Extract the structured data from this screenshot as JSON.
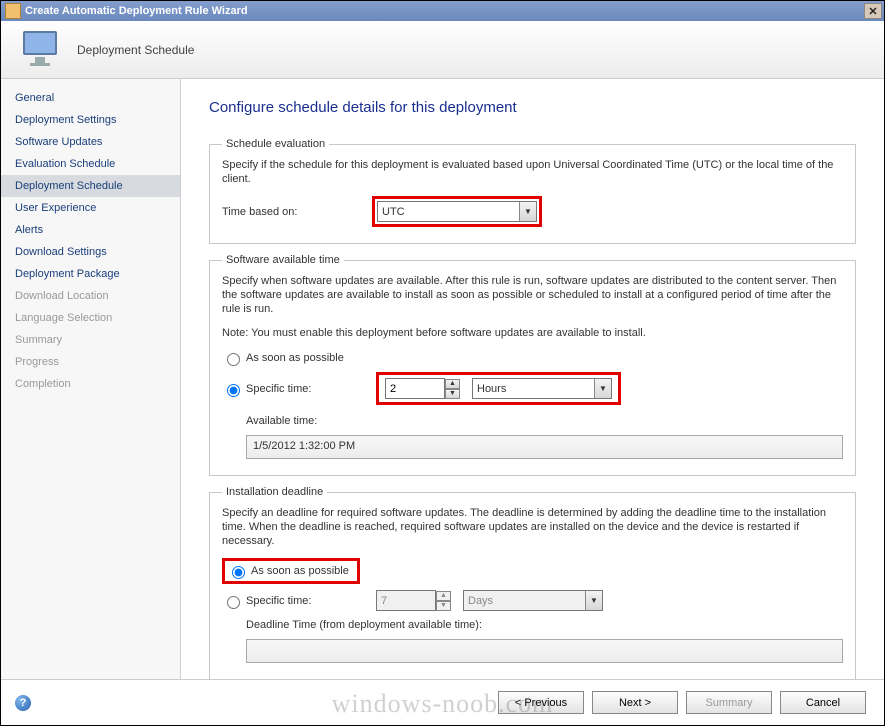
{
  "window": {
    "title": "Create Automatic Deployment Rule Wizard",
    "header_caption": "Deployment Schedule"
  },
  "nav": {
    "items": [
      {
        "label": "General",
        "state": "enabled"
      },
      {
        "label": "Deployment Settings",
        "state": "enabled"
      },
      {
        "label": "Software Updates",
        "state": "enabled"
      },
      {
        "label": "Evaluation Schedule",
        "state": "enabled"
      },
      {
        "label": "Deployment Schedule",
        "state": "selected"
      },
      {
        "label": "User Experience",
        "state": "enabled"
      },
      {
        "label": "Alerts",
        "state": "enabled"
      },
      {
        "label": "Download Settings",
        "state": "enabled"
      },
      {
        "label": "Deployment Package",
        "state": "enabled"
      },
      {
        "label": "Download Location",
        "state": "disabled"
      },
      {
        "label": "Language Selection",
        "state": "disabled"
      },
      {
        "label": "Summary",
        "state": "disabled"
      },
      {
        "label": "Progress",
        "state": "disabled"
      },
      {
        "label": "Completion",
        "state": "disabled"
      }
    ]
  },
  "page": {
    "title": "Configure schedule details for this deployment"
  },
  "schedule_eval": {
    "legend": "Schedule evaluation",
    "desc": "Specify if the schedule for this deployment is evaluated based upon Universal Coordinated Time (UTC) or the local time of the client.",
    "time_based_on_label": "Time based on:",
    "time_based_on_value": "UTC"
  },
  "available": {
    "legend": "Software available time",
    "desc": "Specify when software updates are available. After this rule is run, software updates are distributed to the content server. Then the software updates are available to install as soon as possible or scheduled to install at a configured period of time after the rule is run.",
    "note": "Note: You must enable this deployment before software updates are available to install.",
    "radio_asap": "As soon as possible",
    "radio_specific": "Specific time:",
    "specific_value": "2",
    "specific_unit": "Hours",
    "available_time_label": "Available time:",
    "available_time_value": "1/5/2012 1:32:00 PM"
  },
  "deadline": {
    "legend": "Installation deadline",
    "desc": "Specify an deadline for required software updates. The deadline is determined by adding the deadline time to the installation time. When the deadline is reached, required software updates are installed on the device and the device is restarted if necessary.",
    "radio_asap": "As soon as possible",
    "radio_specific": "Specific time:",
    "specific_value": "7",
    "specific_unit": "Days",
    "deadline_time_label": "Deadline Time (from deployment available time):",
    "deadline_time_value": ""
  },
  "footer": {
    "previous": "< Previous",
    "next": "Next >",
    "summary": "Summary",
    "cancel": "Cancel"
  },
  "watermark": "windows-noob.com"
}
